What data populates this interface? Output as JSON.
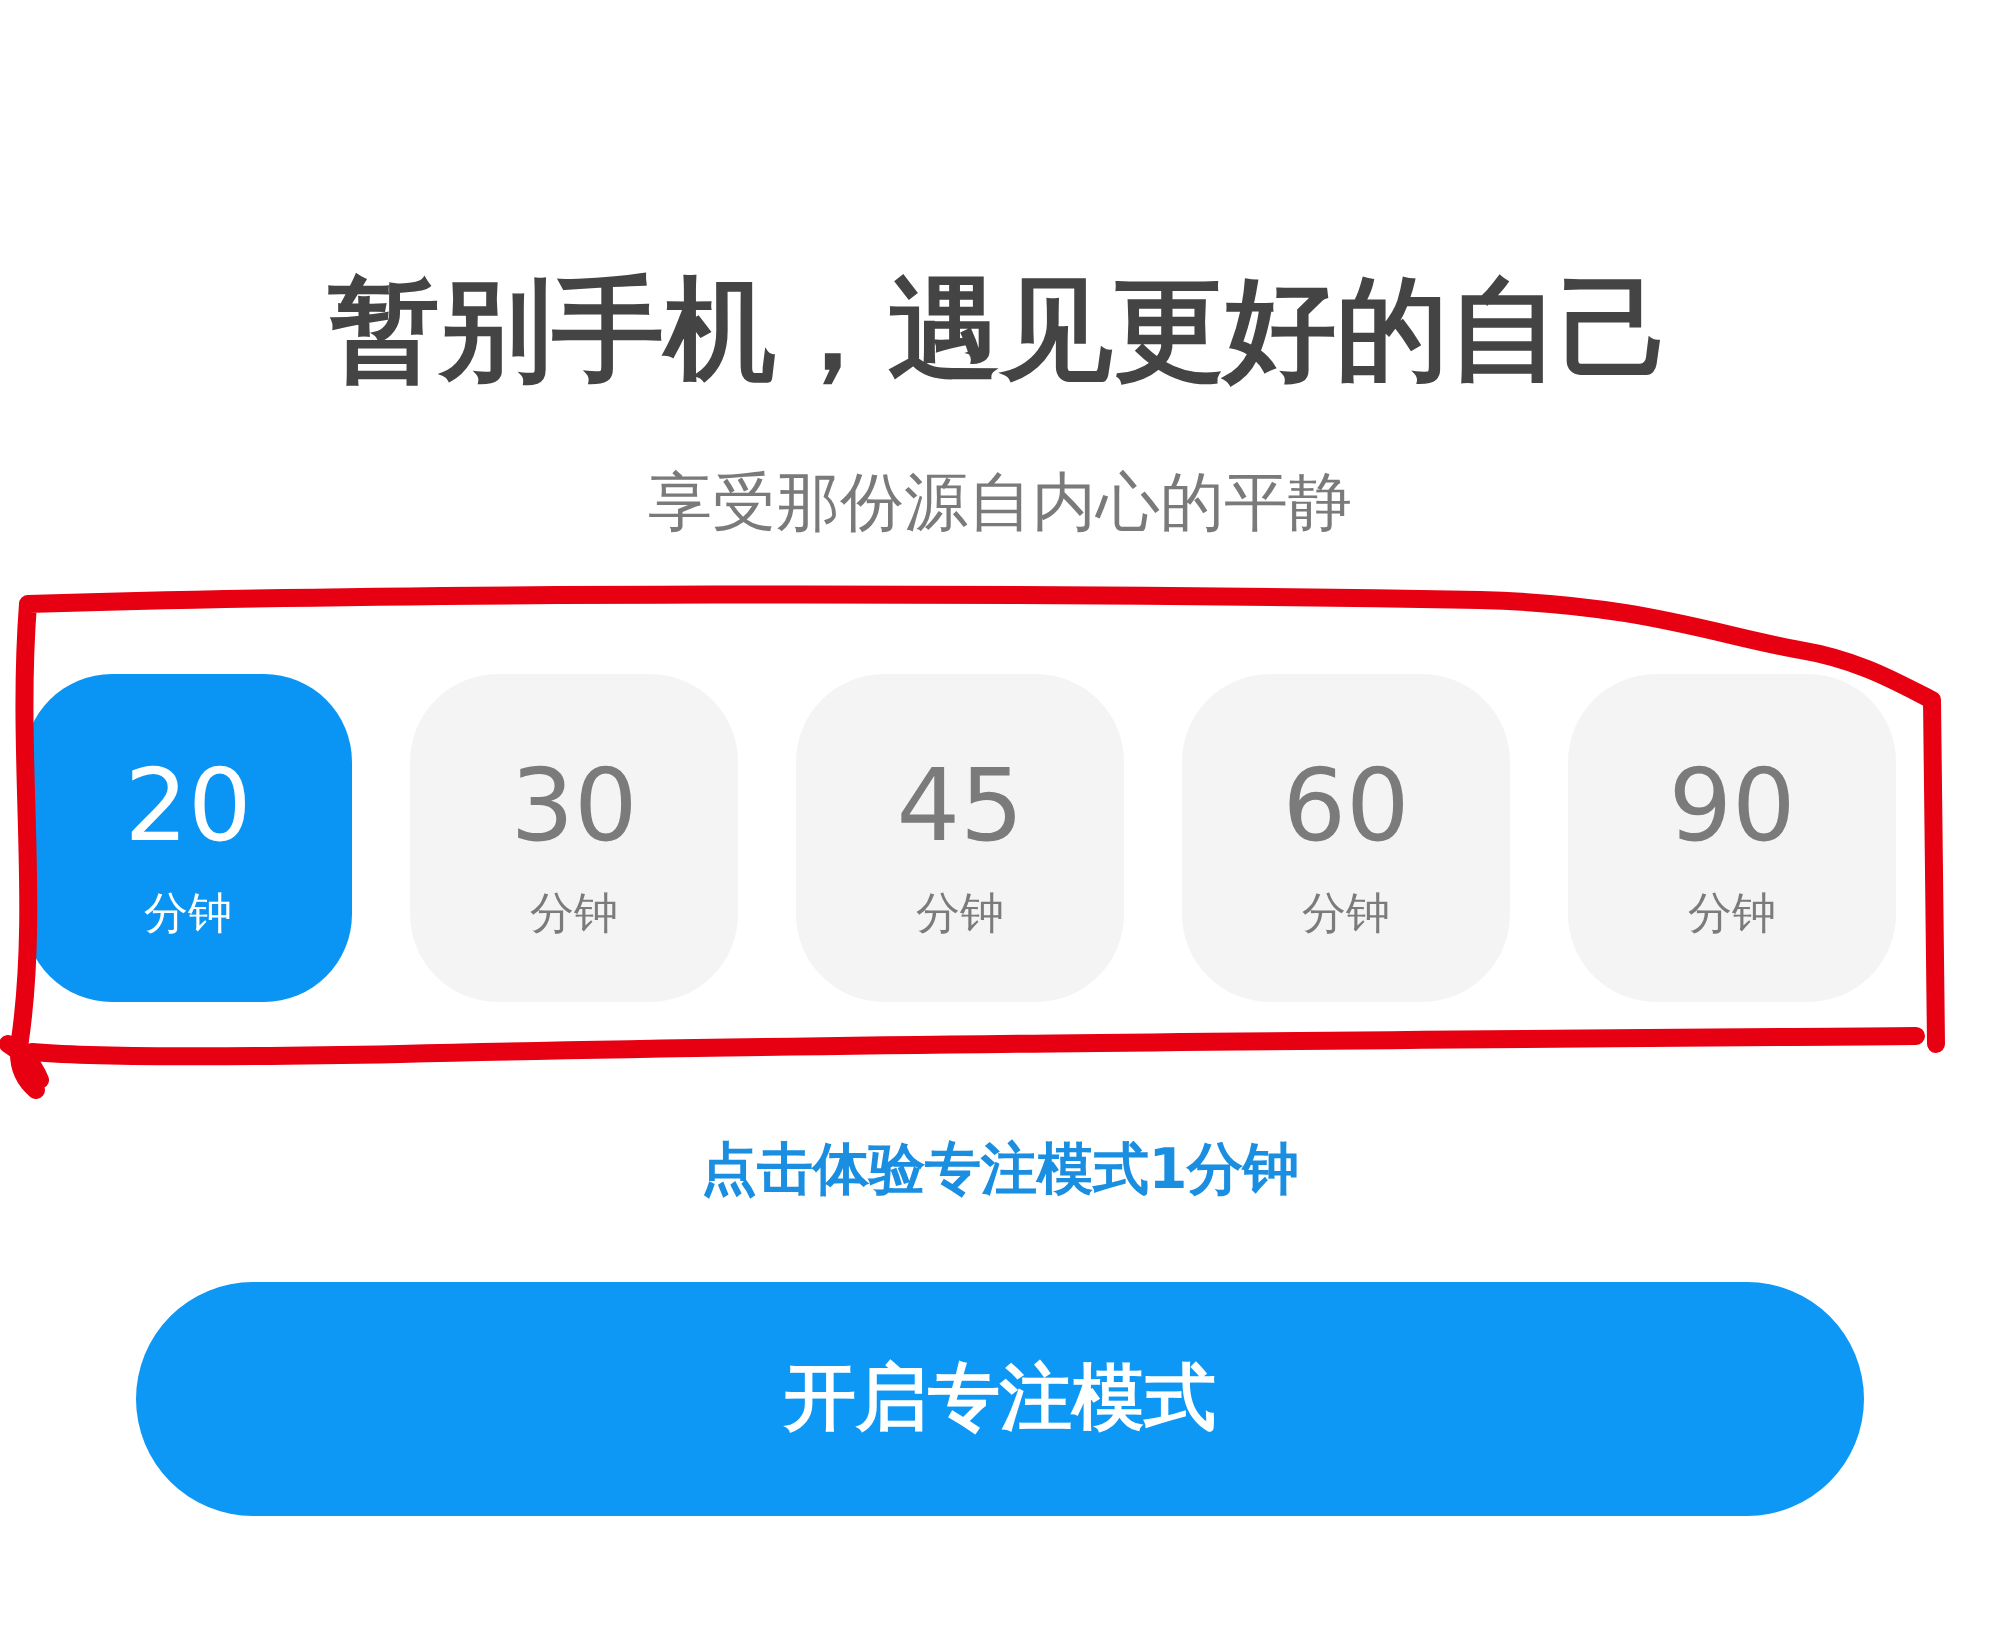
{
  "title": "暂别手机，遇见更好的自己",
  "subtitle": "享受那份源自内心的平静",
  "durations": [
    {
      "value": "20",
      "unit": "分钟",
      "selected": true
    },
    {
      "value": "30",
      "unit": "分钟",
      "selected": false
    },
    {
      "value": "45",
      "unit": "分钟",
      "selected": false
    },
    {
      "value": "60",
      "unit": "分钟",
      "selected": false
    },
    {
      "value": "90",
      "unit": "分钟",
      "selected": false
    }
  ],
  "annotation": {
    "kind": "outline"
  },
  "trial_link": "点击体验专注模式1分钟",
  "start_button": "开启专注模式"
}
